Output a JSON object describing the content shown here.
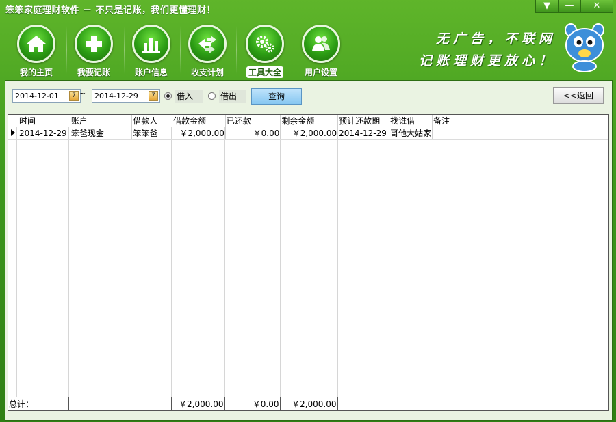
{
  "window": {
    "title": "笨笨家庭理财软件  － 不只是记账，我们更懂理财！",
    "buttons": {
      "dropdown": "▼",
      "minimize": "—",
      "close": "✕"
    }
  },
  "toolbar": {
    "items": [
      {
        "label": "我的主页",
        "icon": "home-icon",
        "active": false
      },
      {
        "label": "我要记账",
        "icon": "plus-icon",
        "active": false
      },
      {
        "label": "账户信息",
        "icon": "bar-chart-icon",
        "active": false
      },
      {
        "label": "收支计划",
        "icon": "plan-arrows-icon",
        "active": false
      },
      {
        "label": "工具大全",
        "icon": "gears-icon",
        "active": true
      },
      {
        "label": "用户设置",
        "icon": "users-icon",
        "active": false
      }
    ]
  },
  "slogan": {
    "line1": "无广告，不联网",
    "line2": "记账理财更放心！"
  },
  "filter": {
    "start_date": "2014-12-01",
    "end_date": "2014-12-29",
    "tilde": "~",
    "calendar_glyph": "7",
    "radio_borrow_in": "借入",
    "radio_borrow_out": "借出",
    "selected": "借入",
    "query_button": "查询",
    "back_button": "<<返回"
  },
  "grid": {
    "columns": [
      "时间",
      "账户",
      "借款人",
      "借款金额",
      "已还款",
      "剩余金额",
      "预计还款期",
      "找谁借",
      "备注"
    ],
    "rows": [
      {
        "time": "2014-12-29",
        "account": "笨爸现金",
        "borrower": "笨笨爸",
        "amount": "￥2,000.00",
        "repaid": "￥0.00",
        "remaining": "￥2,000.00",
        "due": "2014-12-29",
        "lender": "哥他大姑家",
        "note": ""
      }
    ],
    "totals": {
      "label": "总计：",
      "amount": "￥2,000.00",
      "repaid": "￥0.00",
      "remaining": "￥2,000.00"
    }
  },
  "colors": {
    "brand_green": "#3f9a1d",
    "query_blue": "#86c7f1",
    "active_tab_bg": "#ffffff"
  }
}
